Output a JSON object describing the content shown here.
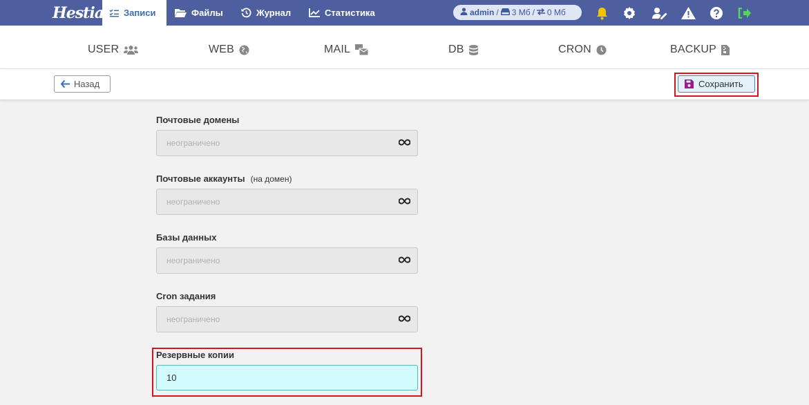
{
  "topbar": {
    "logo": "Hestia",
    "nav": [
      {
        "label": "Записи",
        "icon": "list-check-icon",
        "active": true
      },
      {
        "label": "Файлы",
        "icon": "folder-icon",
        "active": false
      },
      {
        "label": "Журнал",
        "icon": "history-icon",
        "active": false
      },
      {
        "label": "Статистика",
        "icon": "chart-line-icon",
        "active": false
      }
    ],
    "user": {
      "name": "admin",
      "disk": "3 Мб",
      "traffic": "0 Мб",
      "separator": "/"
    }
  },
  "submenu": [
    "USER",
    "WEB",
    "MAIL",
    "DB",
    "CRON",
    "BACKUP"
  ],
  "toolbar": {
    "back_label": "Назад",
    "save_label": "Сохранить"
  },
  "form": {
    "fields": [
      {
        "label": "Почтовые домены",
        "note": "",
        "placeholder": "неограничено"
      },
      {
        "label": "Почтовые аккаунты",
        "note": "(на домен)",
        "placeholder": "неограничено"
      },
      {
        "label": "Базы данных",
        "note": "",
        "placeholder": "неограничено"
      },
      {
        "label": "Cron задания",
        "note": "",
        "placeholder": "неограничено"
      }
    ],
    "backups": {
      "label": "Резервные копии",
      "value": "10"
    }
  },
  "colors": {
    "topbar": "#4e5f9f",
    "accent": "#3e6fb1",
    "highlight": "#d4151b",
    "active_field": "#d2fbfe"
  }
}
